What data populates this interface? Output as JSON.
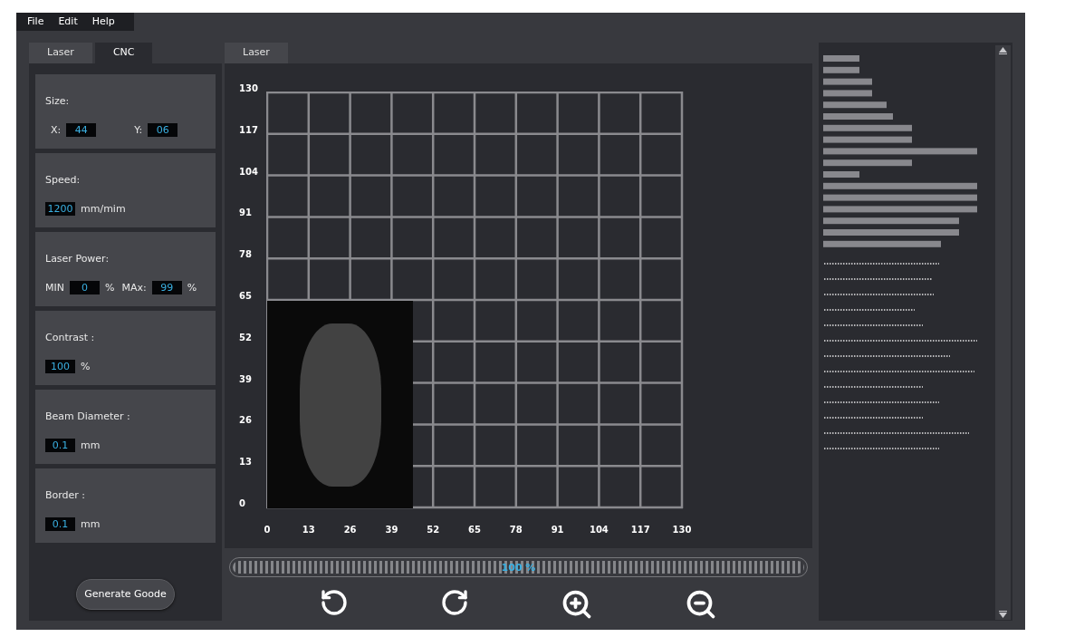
{
  "menu": [
    "File",
    "Edit",
    "Help"
  ],
  "left_tabs": [
    {
      "label": "Laser",
      "selected": false
    },
    {
      "label": "CNC",
      "selected": true
    }
  ],
  "settings": [
    {
      "title": "Size:",
      "items": [
        {
          "prefix": "X:",
          "value": "44"
        },
        {
          "prefix": "Y:",
          "value": "06"
        }
      ]
    },
    {
      "title": "Speed:",
      "items": [
        {
          "value": "1200",
          "unit": "mm/mim"
        }
      ]
    },
    {
      "title": "Laser Power:",
      "items": [
        {
          "prefix": "MIN",
          "value": "0",
          "unit": "%"
        },
        {
          "prefix": "MAx:",
          "value": "99",
          "unit": "%"
        }
      ]
    },
    {
      "title": "Contrast :",
      "items": [
        {
          "value": "100",
          "unit": "%"
        }
      ]
    },
    {
      "title": "Beam Diameter :",
      "items": [
        {
          "value": "0.1",
          "unit": "mm"
        }
      ]
    },
    {
      "title": "Border :",
      "items": [
        {
          "value": "0.1",
          "unit": "mm"
        }
      ]
    }
  ],
  "generate_button": "Generate Goode",
  "canvas_tabs": [
    {
      "label": "Laser",
      "selected": true
    }
  ],
  "canvas": {
    "y_ticks": [
      "130",
      "117",
      "104",
      "91",
      "78",
      "65",
      "52",
      "39",
      "26",
      "13",
      "0"
    ],
    "x_ticks": [
      "0",
      "13",
      "26",
      "39",
      "52",
      "65",
      "78",
      "91",
      "104",
      "117",
      "130"
    ]
  },
  "zoom": {
    "level": 1,
    "reading": "100 %"
  }
}
